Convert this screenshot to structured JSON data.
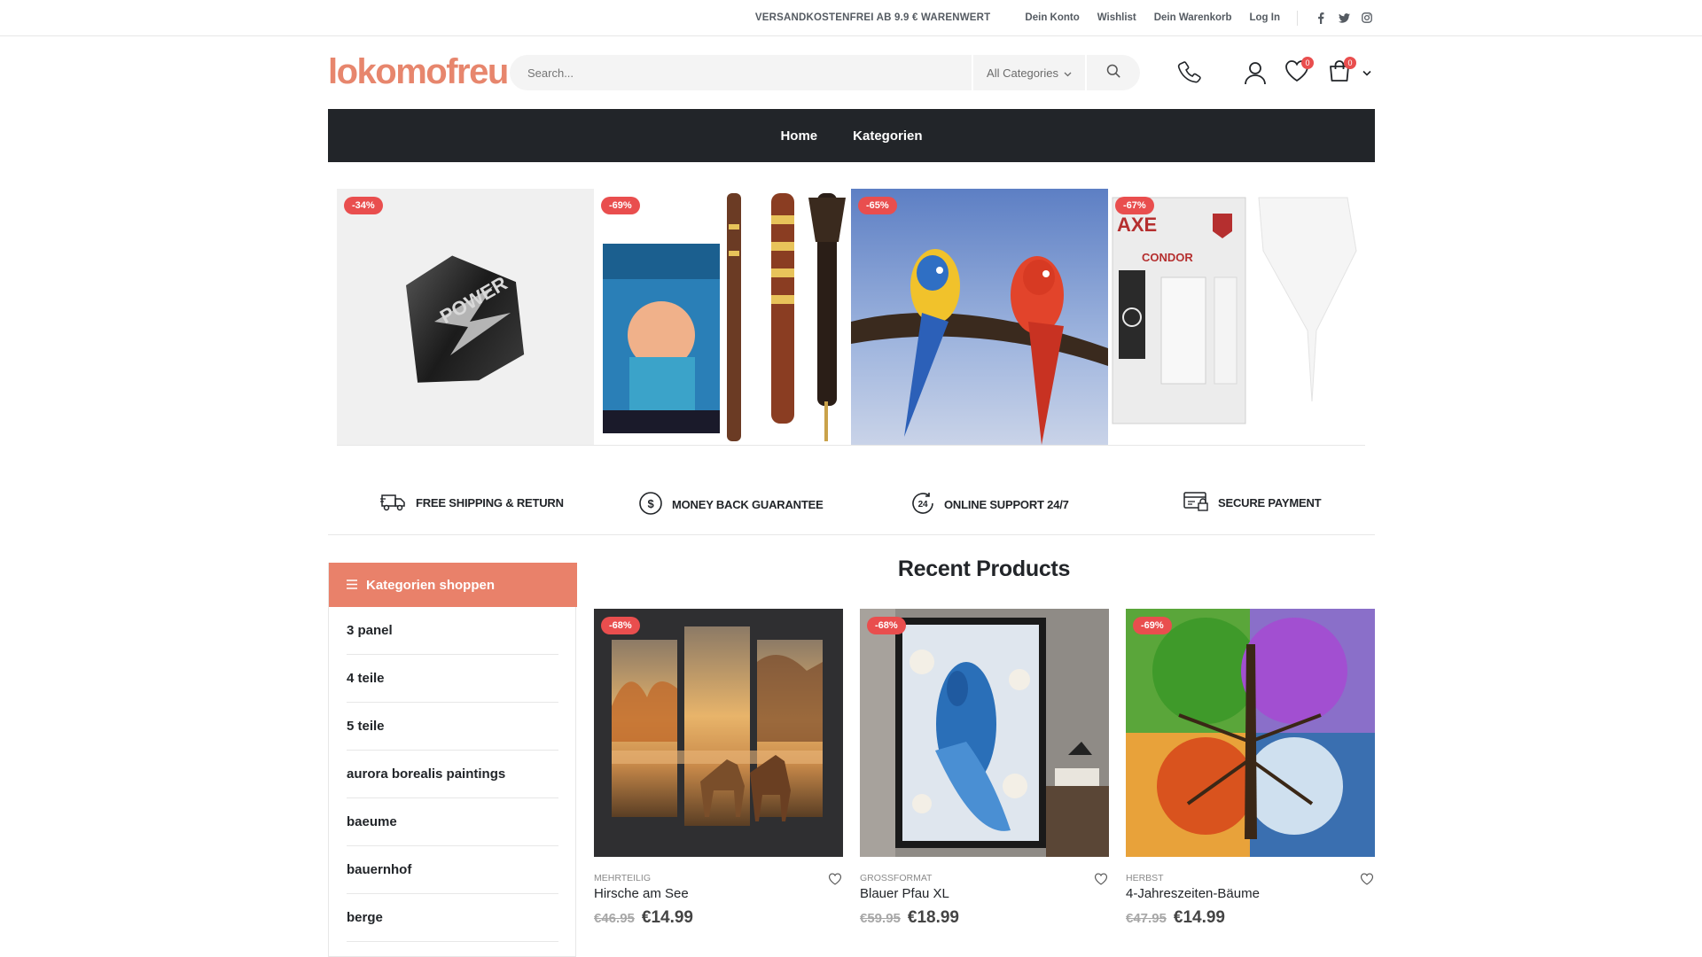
{
  "topbar": {
    "promo": "VERSANDKOSTENFREI AB 9.9 € WARENWERT",
    "links": [
      "Dein Konto",
      "Wishlist",
      "Dein Warenkorb",
      "Log In"
    ],
    "social_icons": [
      "facebook-icon",
      "twitter-icon",
      "instagram-icon"
    ]
  },
  "header": {
    "logo": "lokomofreu",
    "search": {
      "placeholder": "Search...",
      "category": "All Categories"
    },
    "wishlist_count": "0",
    "cart_count": "0"
  },
  "nav": {
    "items": [
      "Home",
      "Kategorien"
    ]
  },
  "hero": {
    "tiles": [
      {
        "discount": "-34%"
      },
      {
        "discount": "-69%"
      },
      {
        "discount": "-65%"
      },
      {
        "discount": "-67%"
      }
    ]
  },
  "features": [
    {
      "label": "FREE SHIPPING & RETURN",
      "icon": "truck-icon"
    },
    {
      "label": "MONEY BACK GUARANTEE",
      "icon": "dollar-circle-icon"
    },
    {
      "label": "ONLINE SUPPORT 24/7",
      "icon": "support-24-icon"
    },
    {
      "label": "SECURE PAYMENT",
      "icon": "secure-card-icon"
    }
  ],
  "sidebar": {
    "title": "Kategorien shoppen",
    "items": [
      "3 panel",
      "4 teile",
      "5 teile",
      "aurora borealis paintings",
      "baeume",
      "bauernhof",
      "berge"
    ]
  },
  "products": {
    "title": "Recent Products",
    "items": [
      {
        "discount": "-68%",
        "category": "MEHRTEILIG",
        "name": "Hirsche am See",
        "old_price": "€46.95",
        "price": "€14.99"
      },
      {
        "discount": "-68%",
        "category": "GROSSFORMAT",
        "name": "Blauer Pfau XL",
        "old_price": "€59.95",
        "price": "€18.99"
      },
      {
        "discount": "-69%",
        "category": "HERBST",
        "name": "4-Jahreszeiten-Bäume",
        "old_price": "€47.95",
        "price": "€14.99"
      }
    ]
  },
  "colors": {
    "accent": "#e9816a",
    "sale": "#e94e4e",
    "dark": "#222529"
  }
}
